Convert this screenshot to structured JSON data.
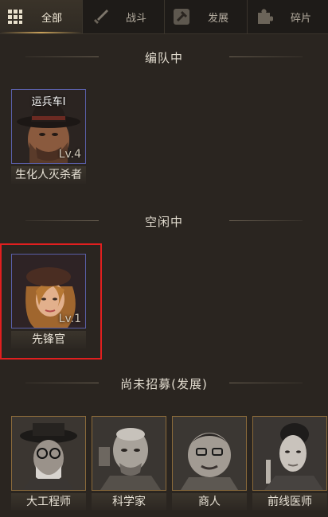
{
  "tabs": [
    {
      "label": "全部",
      "icon": "grid-icon",
      "active": true
    },
    {
      "label": "战斗",
      "icon": "sword-icon",
      "active": false
    },
    {
      "label": "发展",
      "icon": "hammer-icon",
      "active": false
    },
    {
      "label": "碎片",
      "icon": "puzzle-icon",
      "active": false
    }
  ],
  "sections": {
    "in_team": "编队中",
    "idle": "空闲中",
    "unrecruited": "尚未招募(发展)"
  },
  "in_team_heroes": [
    {
      "name": "生化人灭杀者",
      "level": "Lv.4",
      "badge": "运兵车Ⅰ"
    }
  ],
  "idle_heroes": [
    {
      "name": "先锋官",
      "level": "Lv.1"
    }
  ],
  "unrecruited_heroes": [
    {
      "name": "大工程师"
    },
    {
      "name": "科学家"
    },
    {
      "name": "商人"
    },
    {
      "name": "前线医师"
    }
  ],
  "colors": {
    "background": "#2a2520",
    "highlight": "#e01f1f",
    "rare_border": "#5a5fa8",
    "gold_border": "#8a6a3a"
  }
}
